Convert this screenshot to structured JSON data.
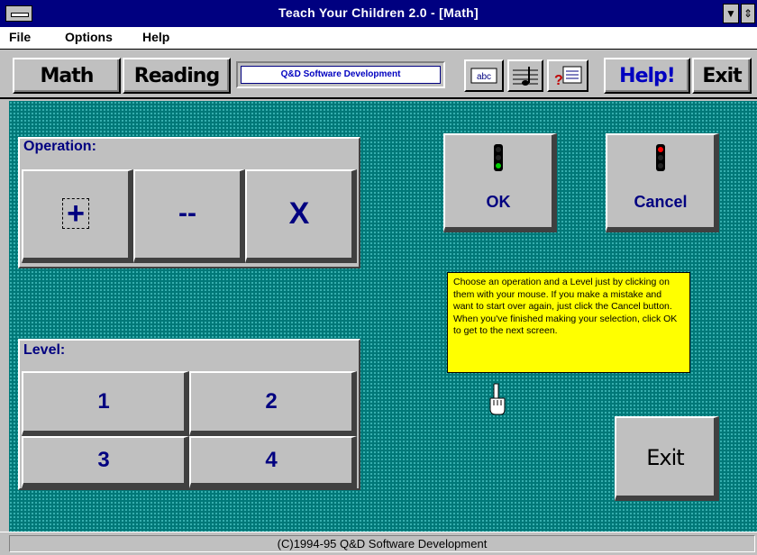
{
  "window": {
    "title": "Teach Your Children 2.0 - [Math]"
  },
  "menu": {
    "items": [
      "File",
      "Options",
      "Help"
    ]
  },
  "toolbar": {
    "math_label": "Math",
    "reading_label": "Reading",
    "brand": "Q&D Software Development",
    "help_label": "Help!",
    "exit_label": "Exit",
    "icons": [
      "abc-icon",
      "music-icon",
      "quiz-icon"
    ]
  },
  "operation": {
    "label": "Operation:",
    "buttons": [
      "+",
      "--",
      "X"
    ]
  },
  "level": {
    "label": "Level:",
    "buttons": [
      "1",
      "2",
      "3",
      "4"
    ]
  },
  "actions": {
    "ok_label": "OK",
    "cancel_label": "Cancel",
    "exit_label": "Exit"
  },
  "instructions": "Choose an operation and a Level just by clicking on them with your mouse.  If you make a mistake and want to start over again, just click the Cancel button.  When you've finished making your selection, click OK to get to the next screen.",
  "status": {
    "text": "(C)1994-95 Q&D Software Development"
  },
  "colors": {
    "title_bar": "#000080",
    "background_teal": "#007878",
    "note_yellow": "#ffff00",
    "button_text": "#000080",
    "ok_light": "#00d000",
    "cancel_light": "#ff0000"
  }
}
